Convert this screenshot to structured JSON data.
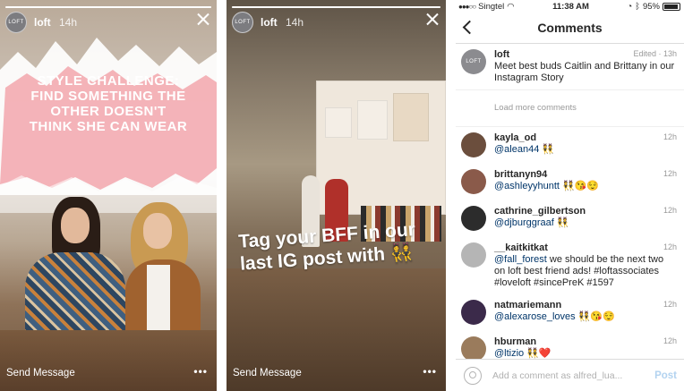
{
  "story_left": {
    "username": "loft",
    "time": "14h",
    "avatar_text": "LOFT",
    "challenge_text": "STYLE CHALLENGE: FIND SOMETHING THE OTHER DOESN'T THINK SHE CAN WEAR",
    "send_message": "Send Message",
    "more": "•••"
  },
  "story_middle": {
    "username": "loft",
    "time": "14h",
    "avatar_text": "LOFT",
    "overlay_text": "Tag your BFF in our last IG post with 👯",
    "send_message": "Send Message",
    "more": "•••"
  },
  "comments_panel": {
    "status_bar": {
      "carrier": "Singtel",
      "signal": "●●●○○",
      "time": "11:38 AM",
      "battery": "95%",
      "battery_level": 0.95
    },
    "title": "Comments",
    "caption": {
      "user": "loft",
      "avatar_text": "LOFT",
      "meta": "Edited · 13h",
      "text": "Meet best buds Caitlin and Brittany in our Instagram Story"
    },
    "load_more": "Load more comments",
    "comments": [
      {
        "user": "kayla_od",
        "time": "12h",
        "mention": "@alean44",
        "text": " 👯",
        "avatar_color": "#6b4e3d"
      },
      {
        "user": "brittanyn94",
        "time": "12h",
        "mention": "@ashleyyhuntt",
        "text": " 👯😘😌",
        "avatar_color": "#8a5a4a"
      },
      {
        "user": "cathrine_gilbertson",
        "time": "12h",
        "mention": "@djburggraaf",
        "text": " 👯",
        "avatar_color": "#2c2c2c"
      },
      {
        "user": "__kaitkitkat",
        "time": "12h",
        "mention": "@fall_forest",
        "text": " we should be the next two on loft best friend ads! #loftassociates #loveloft #sincePreK #1597",
        "avatar_color": "#b5b5b5"
      },
      {
        "user": "natmariemann",
        "time": "12h",
        "mention": "@alexarose_loves",
        "text": " 👯😘😌",
        "avatar_color": "#3b2a4a"
      },
      {
        "user": "hburman",
        "time": "12h",
        "mention": "@ltizio",
        "text": " 👯❤️",
        "avatar_color": "#9a7b5c"
      }
    ],
    "composer": {
      "placeholder": "Add a comment as alfred_lua...",
      "post_label": "Post"
    }
  }
}
